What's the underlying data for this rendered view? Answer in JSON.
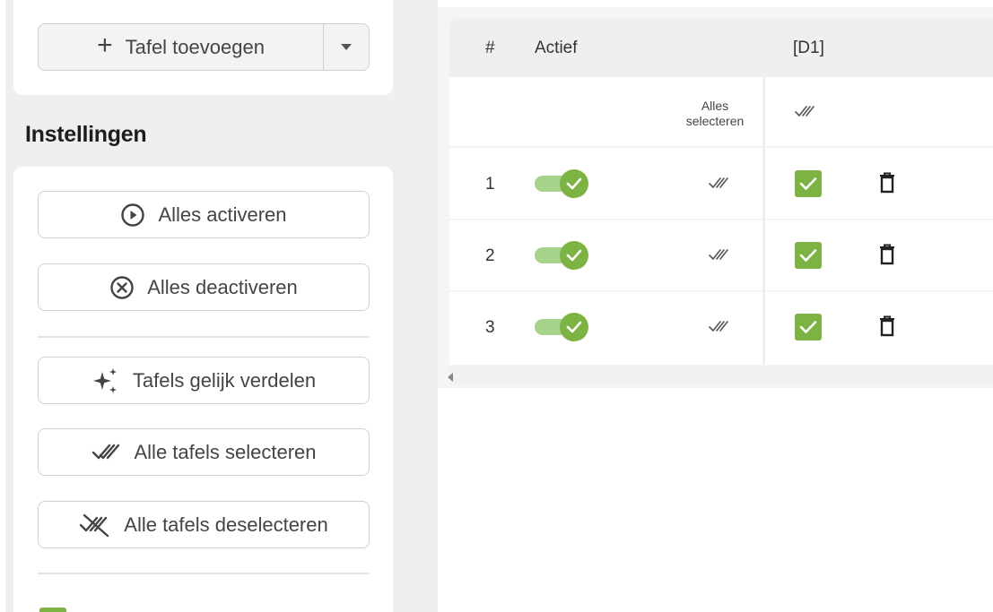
{
  "toolbar": {
    "add_table_label": "Tafel toevoegen"
  },
  "settings": {
    "title": "Instellingen",
    "activate_all": "Alles activeren",
    "deactivate_all": "Alles deactiveren",
    "distribute_tables": "Tafels gelijk verdelen",
    "select_all_tables": "Alle tafels selecteren",
    "deselect_all_tables": "Alle tafels deselecteren"
  },
  "table": {
    "headers": {
      "number": "#",
      "active": "Actief",
      "d1": "[D1]"
    },
    "select_all_label_line1": "Alles",
    "select_all_label_line2": "selecteren",
    "rows": [
      {
        "number": "1",
        "active": true,
        "d1_checked": true
      },
      {
        "number": "2",
        "active": true,
        "d1_checked": true
      },
      {
        "number": "3",
        "active": true,
        "d1_checked": true
      }
    ]
  },
  "colors": {
    "accent": "#7cb342",
    "track": "#a5d38a"
  }
}
